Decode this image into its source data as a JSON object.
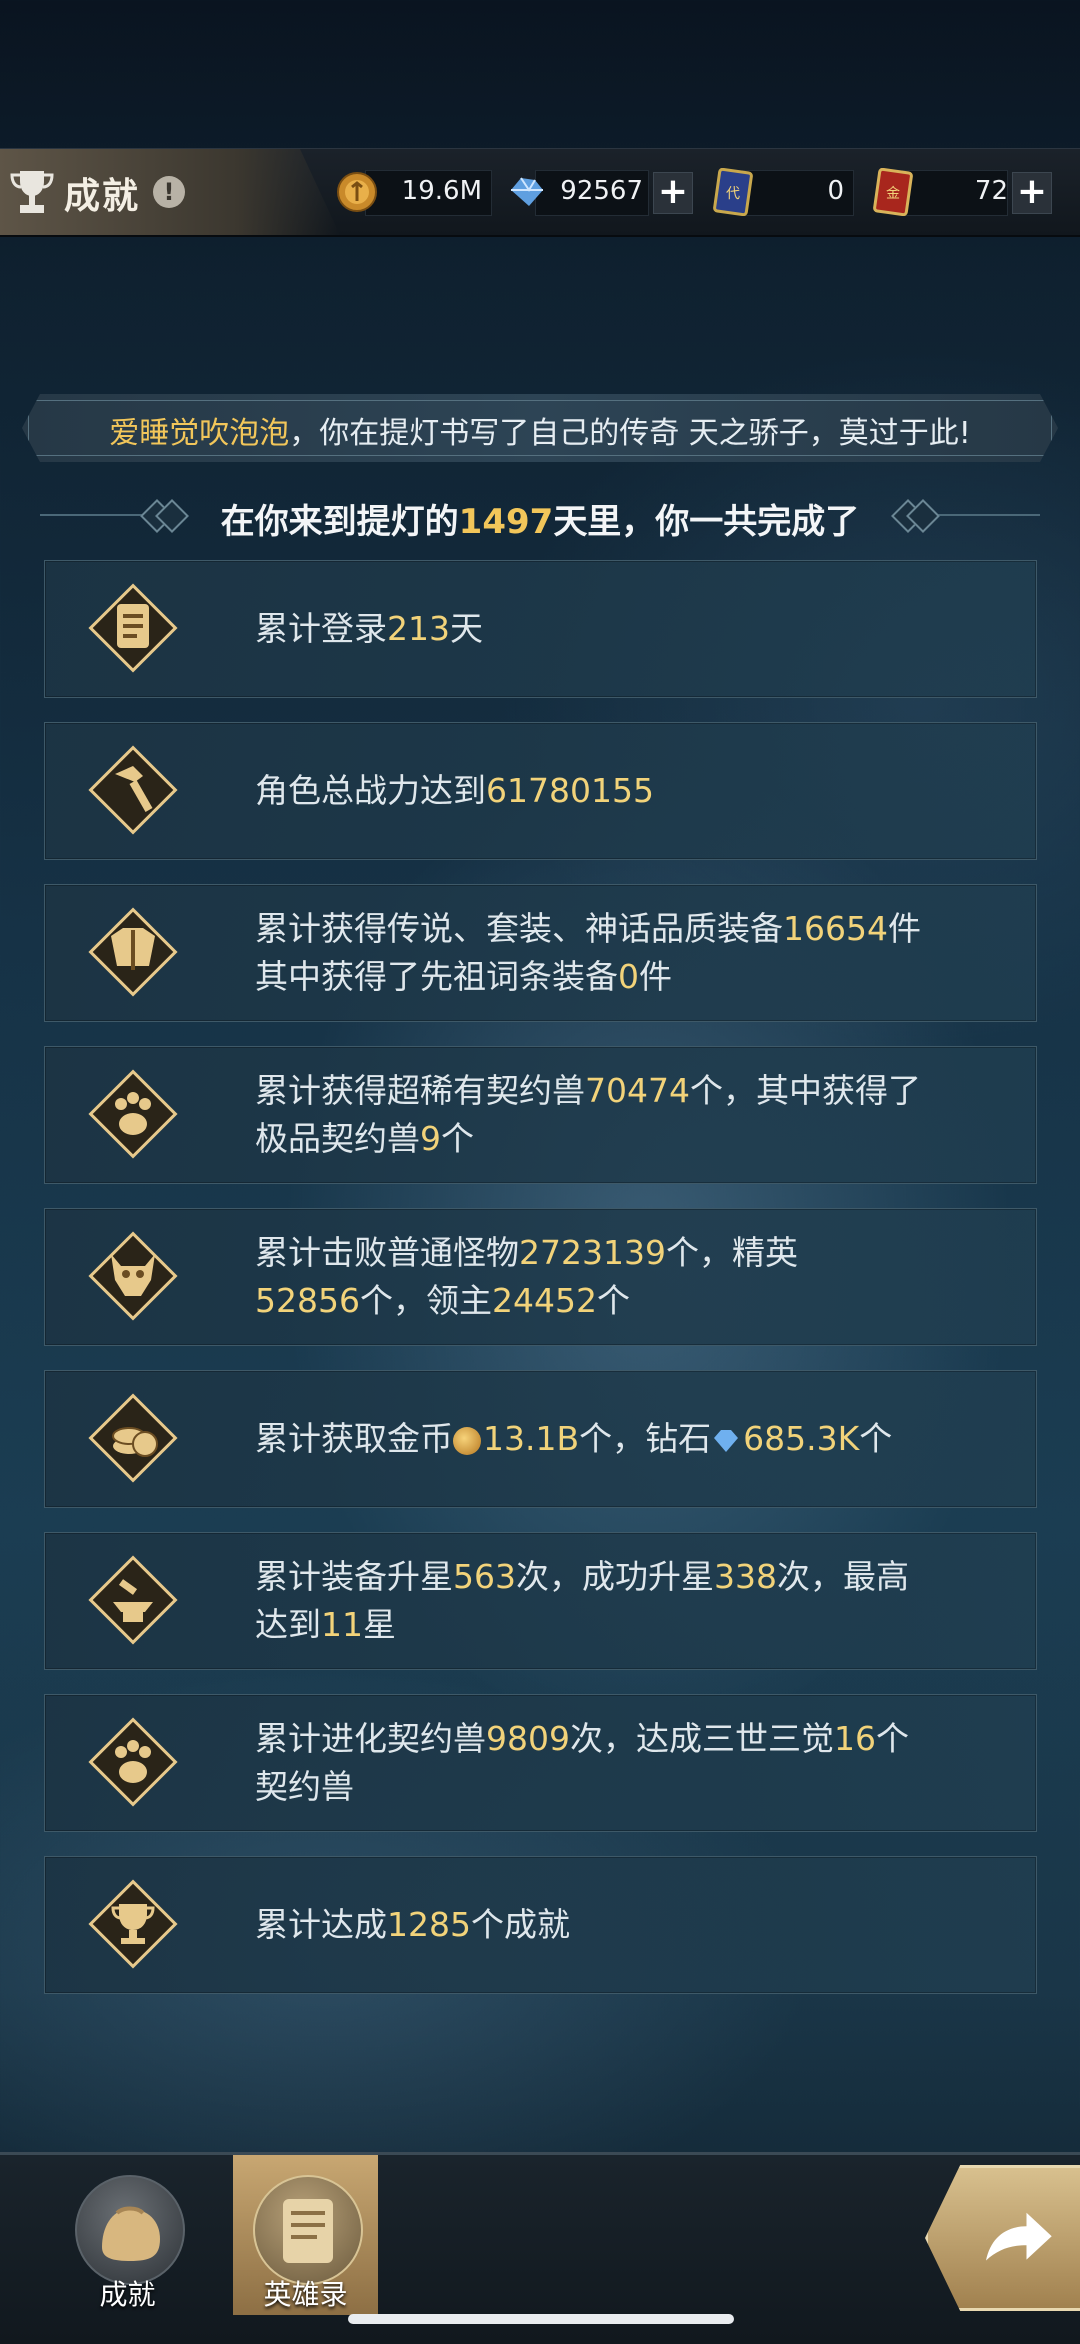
{
  "header": {
    "title": "成就",
    "info_symbol": "!",
    "currencies": [
      {
        "icon": "gold-coin-icon",
        "value": "19.6M"
      },
      {
        "icon": "diamond-icon",
        "value": "92567"
      },
      {
        "icon": "token-card-icon",
        "value": "0"
      },
      {
        "icon": "gold-card-icon",
        "value": "72"
      }
    ],
    "plus": "+"
  },
  "banner": {
    "part1": "爱睡觉吹泡泡",
    "part2": "，你在提灯书写了自己的传奇 天之骄子，莫过于此!"
  },
  "subtitle": {
    "before": "在你来到提灯的",
    "days": "1497",
    "after": "天里，你一共完成了"
  },
  "achievements": [
    {
      "icon": "scroll-icon",
      "segments": [
        {
          "t": "累计登录"
        },
        {
          "t": "213",
          "n": true
        },
        {
          "t": "天"
        }
      ]
    },
    {
      "icon": "hammer-icon",
      "segments": [
        {
          "t": "角色总战力达到"
        },
        {
          "t": "61780155",
          "n": true
        }
      ]
    },
    {
      "icon": "armor-icon",
      "segments": [
        {
          "t": "累计获得传说、套装、神话品质装备"
        },
        {
          "t": "16654",
          "n": true
        },
        {
          "t": "件\n其中获得了先祖词条装备"
        },
        {
          "t": "0",
          "n": true
        },
        {
          "t": "件"
        }
      ]
    },
    {
      "icon": "paw-icon",
      "segments": [
        {
          "t": "累计获得超稀有契约兽"
        },
        {
          "t": "70474",
          "n": true
        },
        {
          "t": "个，其中获得了\n极品契约兽"
        },
        {
          "t": "9",
          "n": true
        },
        {
          "t": "个"
        }
      ]
    },
    {
      "icon": "demon-mask-icon",
      "segments": [
        {
          "t": "累计击败普通怪物"
        },
        {
          "t": "2723139",
          "n": true
        },
        {
          "t": "个，精英\n"
        },
        {
          "t": "52856",
          "n": true
        },
        {
          "t": "个，领主"
        },
        {
          "t": "24452",
          "n": true
        },
        {
          "t": "个"
        }
      ]
    },
    {
      "icon": "coins-icon",
      "segments": [
        {
          "t": "累计获取金币"
        },
        {
          "coin": true
        },
        {
          "t": "13.1B",
          "n": true
        },
        {
          "t": "个，钻石"
        },
        {
          "gem": true
        },
        {
          "t": "685.3K",
          "n": true
        },
        {
          "t": "个"
        }
      ]
    },
    {
      "icon": "anvil-icon",
      "segments": [
        {
          "t": "累计装备升星"
        },
        {
          "t": "563",
          "n": true
        },
        {
          "t": "次，成功升星"
        },
        {
          "t": "338",
          "n": true
        },
        {
          "t": "次，最高\n达到"
        },
        {
          "t": "11",
          "n": true
        },
        {
          "t": "星"
        }
      ]
    },
    {
      "icon": "paw-icon",
      "segments": [
        {
          "t": "累计进化契约兽"
        },
        {
          "t": "9809",
          "n": true
        },
        {
          "t": "次，达成三世三觉"
        },
        {
          "t": "16",
          "n": true
        },
        {
          "t": "个\n契约兽"
        }
      ]
    },
    {
      "icon": "trophy-icon",
      "segments": [
        {
          "t": "累计达成"
        },
        {
          "t": "1285",
          "n": true
        },
        {
          "t": "个成就"
        }
      ]
    }
  ],
  "bottom_nav": [
    {
      "label": "成就",
      "active": false
    },
    {
      "label": "英雄录",
      "active": true
    }
  ],
  "colors": {
    "accent": "#f2c65a",
    "number": "#f2d37a",
    "row_bg": "#1e3a4c"
  }
}
